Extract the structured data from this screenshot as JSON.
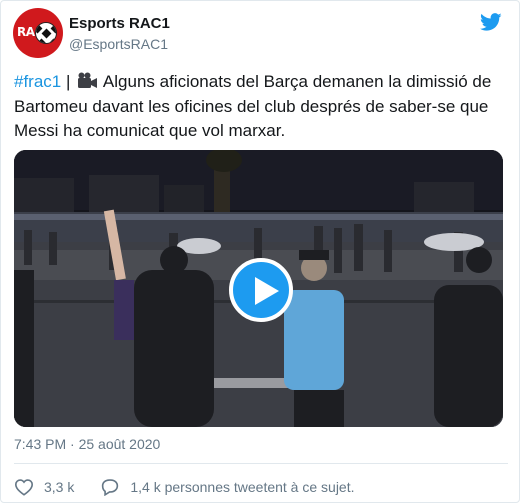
{
  "account": {
    "display_name": "Esports RAC1",
    "handle": "@EsportsRAC1",
    "avatar_text": "RAC"
  },
  "tweet": {
    "hashtag": "#frac1",
    "separator": " |",
    "text": "Alguns aficionats del Barça demanen la dimissió de Bartomeu davant les oficines del club després de saber-se que Messi ha comunicat que vol marxar.",
    "timestamp": "7:43 PM · 25 août 2020"
  },
  "actions": {
    "likes": "3,3 k",
    "conversation": "1,4 k personnes tweetent à ce sujet."
  },
  "colors": {
    "accent": "#1d9bf0",
    "hashtag": "#1b95e0",
    "muted": "#657786",
    "brand_red": "#d0191d"
  },
  "icons": {
    "brand": "twitter-bird-icon",
    "media": "video-camera-icon",
    "play": "play-icon",
    "like": "heart-icon",
    "conversation": "speech-bubble-icon"
  }
}
